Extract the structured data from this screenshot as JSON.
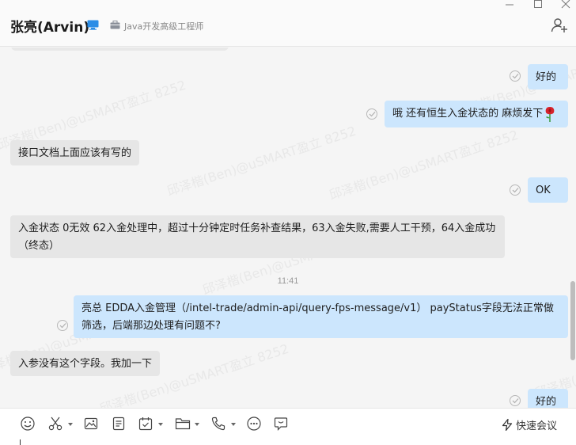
{
  "header": {
    "contact_name": "张亮(Arvin)",
    "job_title": "Java开发高级工程师",
    "icons": [
      "device-icon",
      "briefcase-icon",
      "add-member-icon"
    ]
  },
  "window_controls": [
    "minimize-icon",
    "maximize-icon",
    "close-icon"
  ],
  "watermark_text": "邱泽楷(Ben)@uSMART盈立 8252",
  "messages": [
    {
      "side": "out",
      "text": "好的",
      "status": "sent"
    },
    {
      "side": "out",
      "text": "哦 还有恒生入金状态的 麻烦发下",
      "emoji": "rose",
      "status": "sent"
    },
    {
      "side": "in",
      "text": "接口文档上面应该有写的"
    },
    {
      "side": "out",
      "text": "OK",
      "status": "sent"
    },
    {
      "side": "in",
      "text": "入金状态 0无效 62入金处理中，超过十分钟定时任务补查结果，63入金失败,需要人工干预，64入金成功（终态）"
    },
    {
      "side": "out",
      "text": "亮总 EDDA入金管理（/intel-trade/admin-api/query-fps-message/v1） payStatus字段无法正常做筛选，后端那边处理有问题不?",
      "status": "sent"
    },
    {
      "side": "in",
      "text": "入参没有这个字段。我加一下"
    },
    {
      "side": "out",
      "text": "好的",
      "status": "sent"
    }
  ],
  "timestamp": "11:41",
  "toolbar": {
    "tools": [
      "emoji-icon",
      "scissors-icon",
      "image-icon",
      "document-icon",
      "calendar-check-icon",
      "folder-icon",
      "phone-icon",
      "more-icon",
      "chat-bubble-icon"
    ],
    "quick_meeting_label": "快速会议"
  },
  "colors": {
    "outgoing_bubble": "#cce6fd",
    "incoming_bubble": "#e6e6e6",
    "background": "#f5f5f5"
  }
}
